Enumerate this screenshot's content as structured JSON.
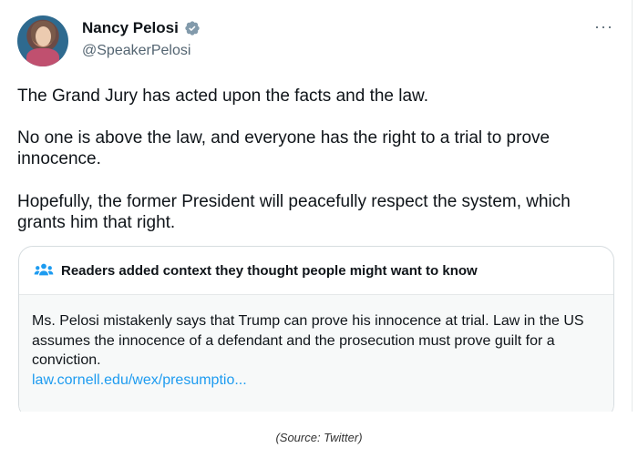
{
  "author": {
    "name": "Nancy Pelosi",
    "handle": "@SpeakerPelosi",
    "verified_badge": "verified-badge-icon",
    "more_label": "···"
  },
  "tweet": {
    "paragraphs": [
      "The Grand Jury has acted upon the facts and the law.",
      "No one is above the law, and everyone has the right to a trial to prove innocence.",
      "Hopefully, the former President will peacefully respect the system, which grants him that right."
    ]
  },
  "community_note": {
    "title": "Readers added context they thought people might want to know",
    "icon": "people-icon",
    "text": "Ms. Pelosi mistakenly says that Trump can prove his innocence at trial. Law in the US assumes the innocence of a defendant and the prosecution must prove guilt for a conviction.",
    "link": "law.cornell.edu/wex/presumptio..."
  },
  "caption": "(Source: Twitter)",
  "colors": {
    "accent": "#1d9bf0",
    "text": "#0f1419",
    "muted": "#536471"
  }
}
